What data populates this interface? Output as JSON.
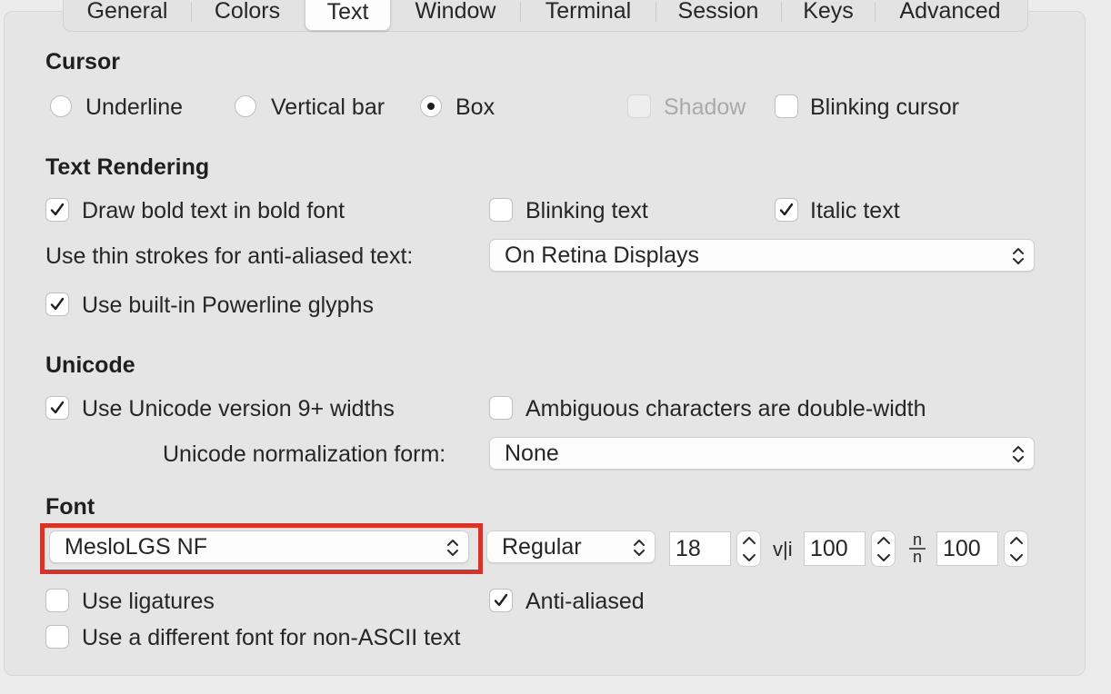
{
  "tabs": [
    {
      "label": "General"
    },
    {
      "label": "Colors"
    },
    {
      "label": "Text"
    },
    {
      "label": "Window"
    },
    {
      "label": "Terminal"
    },
    {
      "label": "Session"
    },
    {
      "label": "Keys"
    },
    {
      "label": "Advanced"
    }
  ],
  "active_tab": "Text",
  "cursor": {
    "heading": "Cursor",
    "options": [
      "Underline",
      "Vertical bar",
      "Box"
    ],
    "selected": "Box",
    "shadow_label": "Shadow",
    "shadow_checked": false,
    "shadow_enabled": false,
    "blinking_label": "Blinking cursor",
    "blinking_checked": false
  },
  "text_rendering": {
    "heading": "Text Rendering",
    "bold_label": "Draw bold text in bold font",
    "bold_checked": true,
    "blink_text_label": "Blinking text",
    "blink_text_checked": false,
    "italic_label": "Italic text",
    "italic_checked": true,
    "thin_strokes_label": "Use thin strokes for anti-aliased text:",
    "thin_strokes_value": "On Retina Displays",
    "powerline_label": "Use built-in Powerline glyphs",
    "powerline_checked": true
  },
  "unicode": {
    "heading": "Unicode",
    "widths_label": "Use Unicode version 9+ widths",
    "widths_checked": true,
    "ambiguous_label": "Ambiguous characters are double-width",
    "ambiguous_checked": false,
    "normalization_label": "Unicode normalization form:",
    "normalization_value": "None"
  },
  "font": {
    "heading": "Font",
    "family": "MesloLGS NF",
    "style": "Regular",
    "size": "18",
    "h_spacing_icon": "v|i",
    "h_spacing": "100",
    "v_spacing_icon": "n/n",
    "v_spacing": "100",
    "ligatures_label": "Use ligatures",
    "ligatures_checked": false,
    "antialiased_label": "Anti-aliased",
    "antialiased_checked": true,
    "non_ascii_label": "Use a different font for non-ASCII text",
    "non_ascii_checked": false
  },
  "colors": {
    "highlight": "#d63429",
    "panel": "#e5e5e5",
    "text": "#262626"
  }
}
